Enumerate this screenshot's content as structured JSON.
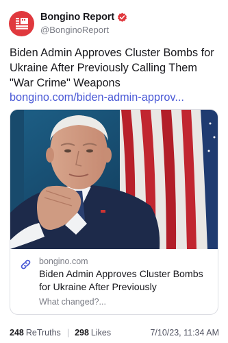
{
  "post": {
    "author": {
      "display_name": "Bongino Report",
      "handle": "@BonginoReport",
      "verified": true,
      "avatar_icon": "bongino-report-logo",
      "avatar_color": "#e0393e"
    },
    "text": "Biden Admin Approves Cluster Bombs for Ukraine After Previously Calling Them \"War Crime\" Weapons",
    "link_text": "bongino.com/biden-admin-approv..."
  },
  "link_card": {
    "domain": "bongino.com",
    "title": "Biden Admin Approves Cluster Bombs for Ukraine After Previously",
    "description": "What changed?...",
    "icon": "link-icon"
  },
  "stats": {
    "retruths_count": "248",
    "retruths_label": "ReTruths",
    "likes_count": "298",
    "likes_label": "Likes",
    "timestamp": "7/10/23, 11:34 AM"
  },
  "colors": {
    "link": "#4a59d6",
    "brand": "#e0393e",
    "verified": "#e0393e"
  }
}
